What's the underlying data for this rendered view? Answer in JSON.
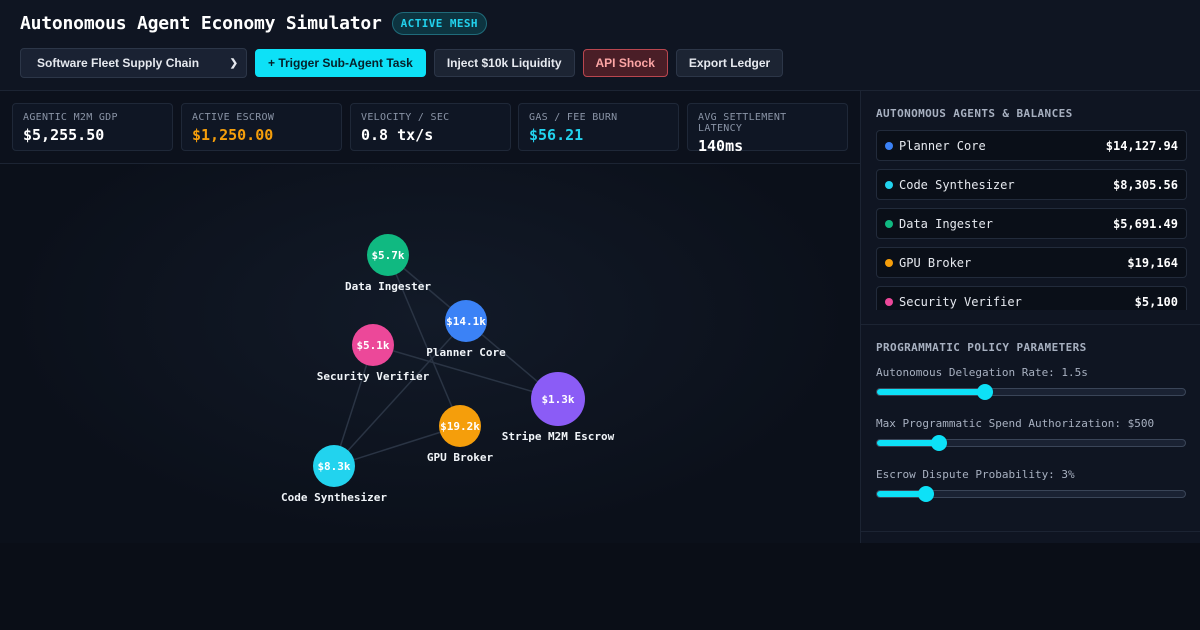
{
  "header": {
    "title": "Autonomous Agent Economy Simulator",
    "badge": "ACTIVE MESH",
    "scenario_select": "Software Fleet Supply Chain",
    "buttons": {
      "trigger": "+ Trigger Sub-Agent Task",
      "inject": "Inject $10k Liquidity",
      "shock": "API Shock",
      "export": "Export Ledger"
    }
  },
  "stats": [
    {
      "label": "AGENTIC M2M GDP",
      "value": "$5,255.50",
      "color": "#ffffff"
    },
    {
      "label": "ACTIVE ESCROW",
      "value": "$1,250.00",
      "color": "#f59e0b"
    },
    {
      "label": "VELOCITY / SEC",
      "value": "0.8 tx/s",
      "color": "#ffffff"
    },
    {
      "label": "GAS / FEE BURN",
      "value": "$56.21",
      "color": "#22d3ee"
    },
    {
      "label": "AVG SETTLEMENT LATENCY",
      "value": "140ms",
      "color": "#ffffff"
    }
  ],
  "graph": {
    "nodes": [
      {
        "id": "data",
        "name": "Data Ingester",
        "value": "$5.7k",
        "color": "#10b981"
      },
      {
        "id": "planner",
        "name": "Planner Core",
        "value": "$14.1k",
        "color": "#3b82f6"
      },
      {
        "id": "security",
        "name": "Security Verifier",
        "value": "$5.1k",
        "color": "#ec4899"
      },
      {
        "id": "escrow",
        "name": "Stripe M2M Escrow",
        "value": "$1.3k",
        "color": "#8b5cf6"
      },
      {
        "id": "gpu",
        "name": "GPU Broker",
        "value": "$19.2k",
        "color": "#f59e0b"
      },
      {
        "id": "code",
        "name": "Code Synthesizer",
        "value": "$8.3k",
        "color": "#22d3ee"
      }
    ],
    "edges": [
      [
        "data",
        "planner"
      ],
      [
        "data",
        "gpu"
      ],
      [
        "planner",
        "escrow"
      ],
      [
        "security",
        "escrow"
      ],
      [
        "security",
        "code"
      ],
      [
        "planner",
        "code"
      ],
      [
        "code",
        "gpu"
      ]
    ]
  },
  "agents": {
    "heading": "AUTONOMOUS AGENTS & BALANCES",
    "items": [
      {
        "name": "Planner Core",
        "balance": "$14,127.94",
        "color": "#3b82f6"
      },
      {
        "name": "Code Synthesizer",
        "balance": "$8,305.56",
        "color": "#22d3ee"
      },
      {
        "name": "Data Ingester",
        "balance": "$5,691.49",
        "color": "#10b981"
      },
      {
        "name": "GPU Broker",
        "balance": "$19,164",
        "color": "#f59e0b"
      },
      {
        "name": "Security Verifier",
        "balance": "$5,100",
        "color": "#ec4899"
      }
    ]
  },
  "policy": {
    "heading": "PROGRAMMATIC POLICY PARAMETERS",
    "sliders": [
      {
        "label": "Autonomous Delegation Rate: 1.5s",
        "fraction": 0.35
      },
      {
        "label": "Max Programmatic Spend Authorization: $500",
        "fraction": 0.2
      },
      {
        "label": "Escrow Dispute Probability: 3%",
        "fraction": 0.16
      }
    ]
  }
}
